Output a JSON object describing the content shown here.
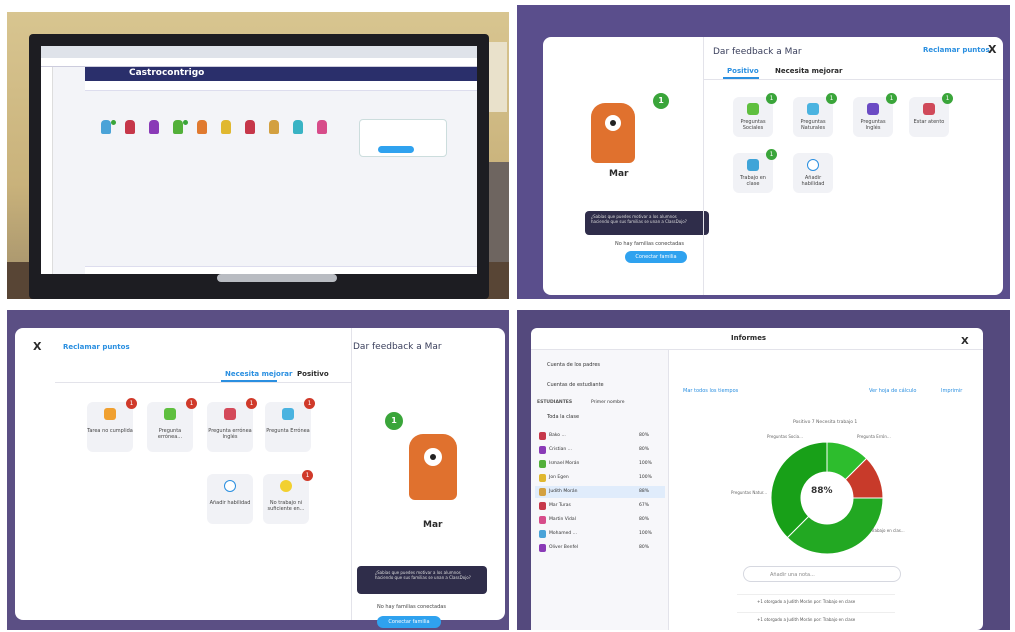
{
  "board": {
    "class_title": "Castrocontrigo"
  },
  "feedback_positive": {
    "title": "Dar feedback a Mar",
    "claim_points": "Reclamar puntos",
    "close": "X",
    "tabs": [
      "Positivo",
      "Necesita mejorar"
    ],
    "student_name": "Mar",
    "points_badge": "1",
    "skills": [
      {
        "label": "Preguntas Sociales",
        "badge": "1"
      },
      {
        "label": "Preguntas Naturales",
        "badge": "1"
      },
      {
        "label": "Preguntas Inglés",
        "badge": "1"
      },
      {
        "label": "Estar atento",
        "badge": "1"
      },
      {
        "label": "Trabajo en clase",
        "badge": "1"
      },
      {
        "label": "Añadir habilidad",
        "badge": ""
      }
    ],
    "tip_text": "¿Sabías que puedes motivar a los alumnos haciendo que sus familias se unan a ClassDojo?",
    "families_text": "No hay familias conectadas",
    "connect_button": "Conectar familia"
  },
  "feedback_needs_work": {
    "title": "Dar feedback a Mar",
    "claim_points": "Reclamar puntos",
    "close": "X",
    "tabs": [
      "Positivo",
      "Necesita mejorar"
    ],
    "student_name": "Mar",
    "points_badge": "1",
    "skills": [
      {
        "label": "Pregunta Errónea",
        "badge": "1"
      },
      {
        "label": "Pregunta errónea Inglés",
        "badge": "1"
      },
      {
        "label": "Pregunta errónea...",
        "badge": "1"
      },
      {
        "label": "Tarea no cumplida",
        "badge": "1"
      },
      {
        "label": "No trabajo ni suficiente en...",
        "badge": "1"
      },
      {
        "label": "Añadir habilidad",
        "badge": ""
      }
    ],
    "tip_text": "¿Sabías que puedes motivar a los alumnos haciendo que sus familias se unan a ClassDojo?",
    "families_text": "No hay familias conectadas",
    "connect_button": "Conectar familia"
  },
  "reports": {
    "title": "Informes",
    "close": "X",
    "sidebar": {
      "parents_account": "Cuenta de los padres",
      "student_account": "Cuentas de estudiante",
      "students_header": "ESTUDIANTES",
      "sort": "Primer nombre",
      "whole_class": "Toda la clase",
      "students": [
        {
          "name": "Bako ...",
          "pct": "80%"
        },
        {
          "name": "Cristian ...",
          "pct": "80%"
        },
        {
          "name": "Ismael Morán",
          "pct": "100%"
        },
        {
          "name": "Jon Egen",
          "pct": "100%"
        },
        {
          "name": "Judith Morán",
          "pct": "88%"
        },
        {
          "name": "Mar Turas",
          "pct": "67%"
        },
        {
          "name": "Martin Vidal",
          "pct": "80%"
        },
        {
          "name": "Mohamed ...",
          "pct": "100%"
        },
        {
          "name": "Oliver Benfel",
          "pct": "80%"
        }
      ]
    },
    "time_filter": "Mar todos los tiempos",
    "spreadsheet_link": "Ver hoja de cálculo",
    "print_link": "Imprimir",
    "legend": "Positivo  7   Necesita trabajo  1",
    "chart_center": "88%",
    "slice_labels": [
      "Preguntas Socia...",
      "Pregunta Errón...",
      "Preguntas Natur...",
      "Trabajo en clas..."
    ],
    "note_placeholder": "Añadir una nota...",
    "feed_items": [
      "+1 otorgado a Judith Morán por: Trabajo en clase",
      "+1 otorgado a Judith Morán por: Trabajo en clase"
    ]
  },
  "chart_data": {
    "type": "pie",
    "categories": [
      "Preguntas Sociales",
      "Pregunta Errónea",
      "Preguntas Naturales",
      "Trabajo en clase"
    ],
    "values": [
      1,
      1,
      3,
      3
    ],
    "title": "88%",
    "colors": [
      "#2dbd2d",
      "#c83a2a",
      "#22a822",
      "#18a018"
    ]
  }
}
